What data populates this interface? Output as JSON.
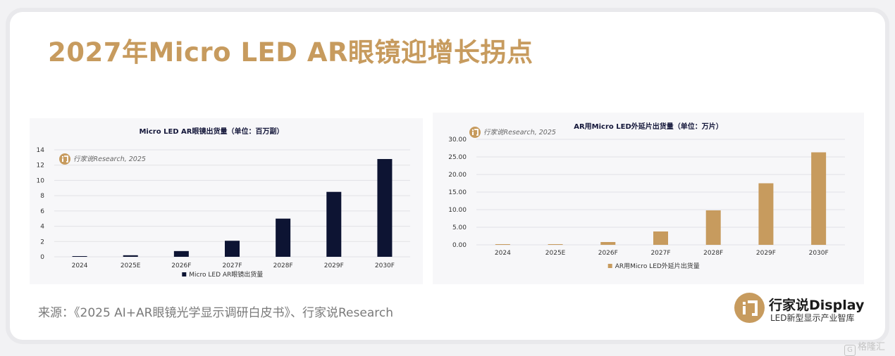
{
  "page": {
    "title": "2027年Micro LED AR眼镜迎增长拐点",
    "source": "来源：《2025 AI+AR眼镜光学显示调研白皮书》、行家说Research",
    "brand": {
      "name": "行家说Display",
      "subtitle": "LED新型显示产业智库",
      "accent_color": "#c79b5e"
    },
    "watermark_corner": "格隆汇"
  },
  "chart_data": [
    {
      "type": "bar",
      "title": "Micro LED AR眼镜出货量（单位：百万副）",
      "watermark": "行家说Research, 2025",
      "categories": [
        "2024",
        "2025E",
        "2026F",
        "2027F",
        "2028F",
        "2029F",
        "2030F"
      ],
      "series": [
        {
          "name": "Micro LED AR眼镜出货量",
          "values": [
            0.08,
            0.2,
            0.75,
            2.1,
            5.0,
            8.5,
            12.8
          ],
          "color": "#0d1433"
        }
      ],
      "yticks": [
        "0",
        "2",
        "4",
        "6",
        "8",
        "10",
        "12",
        "14"
      ],
      "ylim": [
        0,
        14
      ],
      "grid": true,
      "legend": "bottom"
    },
    {
      "type": "bar",
      "title": "AR用Micro LED外延片出货量（单位：万片）",
      "watermark": "行家说Research, 2025",
      "categories": [
        "2024",
        "2025E",
        "2026F",
        "2027F",
        "2028F",
        "2029F",
        "2030F"
      ],
      "series": [
        {
          "name": "AR用Micro LED外延片出货量",
          "values": [
            0.05,
            0.15,
            0.8,
            3.8,
            9.8,
            17.5,
            26.3
          ],
          "color": "#c79b5e"
        }
      ],
      "yticks": [
        "0.00",
        "5.00",
        "10.00",
        "15.00",
        "20.00",
        "25.00",
        "30.00"
      ],
      "ylim": [
        0,
        30
      ],
      "grid": true,
      "legend": "bottom"
    }
  ]
}
